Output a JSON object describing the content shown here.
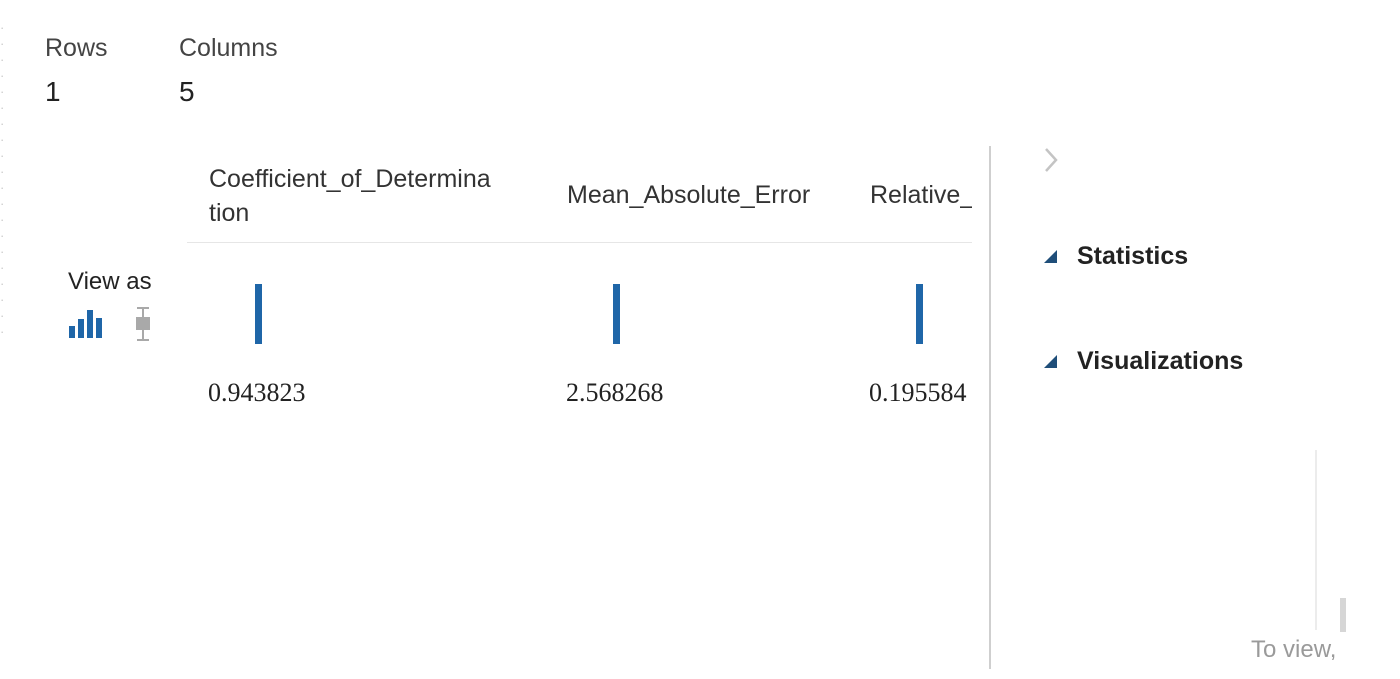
{
  "summary": {
    "rows_label": "Rows",
    "rows_value": "1",
    "columns_label": "Columns",
    "columns_value": "5"
  },
  "view_as": {
    "label": "View as",
    "histogram_icon": "histogram-icon",
    "boxplot_icon": "boxplot-icon"
  },
  "table": {
    "columns": [
      {
        "header_line1": "Coefficient_of_Determina",
        "header_line2": "tion",
        "value": "0.943823"
      },
      {
        "header_line1": "Mean_Absolute_Error",
        "header_line2": "",
        "value": "2.568268"
      },
      {
        "header_line1": "Relative_",
        "header_line2": "",
        "value": "0.195584"
      }
    ]
  },
  "right_panel": {
    "collapse_icon": "chevron-right-icon",
    "statistics_label": "Statistics",
    "visualizations_label": "Visualizations",
    "hint_text": "To view,"
  },
  "colors": {
    "accent_bar": "#1f66a8",
    "triangle": "#1f4e79",
    "divider": "#cfcfcf"
  }
}
